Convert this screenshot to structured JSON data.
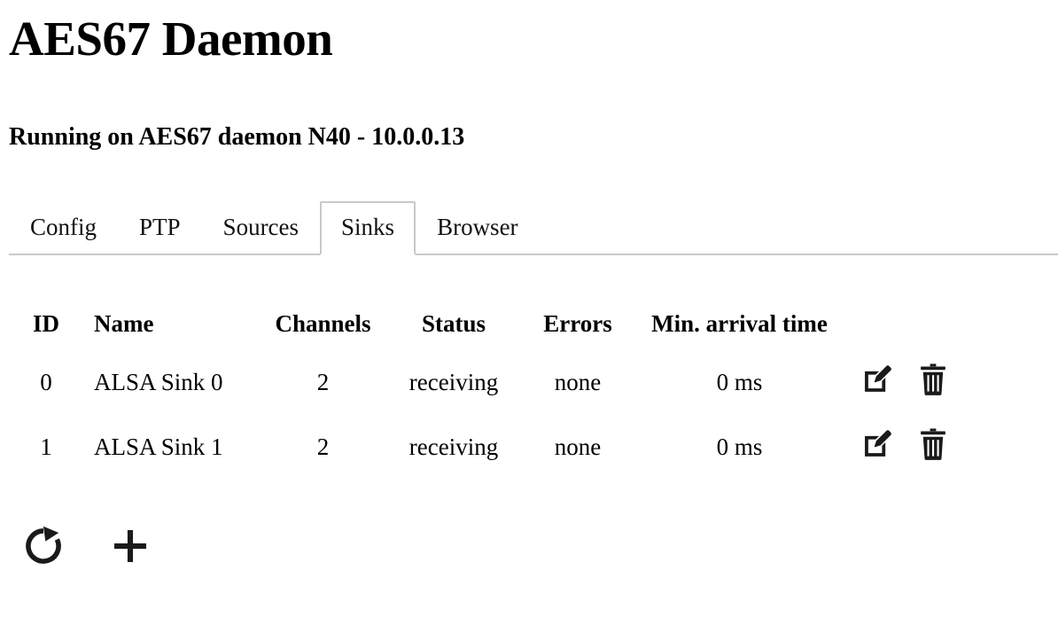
{
  "header": {
    "title": "AES67 Daemon",
    "subtitle": "Running on AES67 daemon N40 - 10.0.0.13"
  },
  "tabs": [
    {
      "label": "Config",
      "name": "tab-config",
      "active": false
    },
    {
      "label": "PTP",
      "name": "tab-ptp",
      "active": false
    },
    {
      "label": "Sources",
      "name": "tab-sources",
      "active": false
    },
    {
      "label": "Sinks",
      "name": "tab-sinks",
      "active": true
    },
    {
      "label": "Browser",
      "name": "tab-browser",
      "active": false
    }
  ],
  "table": {
    "columns": [
      {
        "key": "id",
        "label": "ID"
      },
      {
        "key": "name",
        "label": "Name"
      },
      {
        "key": "channels",
        "label": "Channels"
      },
      {
        "key": "status",
        "label": "Status"
      },
      {
        "key": "errors",
        "label": "Errors"
      },
      {
        "key": "arrival",
        "label": "Min. arrival time"
      }
    ],
    "rows": [
      {
        "id": "0",
        "name": "ALSA Sink 0",
        "channels": "2",
        "status": "receiving",
        "errors": "none",
        "arrival": "0 ms",
        "edit_icon": "edit-pencil-square-icon",
        "delete_icon": "trash-icon"
      },
      {
        "id": "1",
        "name": "ALSA Sink 1",
        "channels": "2",
        "status": "receiving",
        "errors": "none",
        "arrival": "0 ms",
        "edit_icon": "edit-pencil-square-icon",
        "delete_icon": "trash-icon"
      }
    ]
  },
  "actions": [
    {
      "name": "refresh-button",
      "icon": "refresh-icon"
    },
    {
      "name": "add-sink-button",
      "icon": "plus-icon"
    }
  ],
  "colors": {
    "background": "#ffffff",
    "text": "#000000",
    "tab_border": "#c9c9c9",
    "icon": "#1a1a1a"
  }
}
